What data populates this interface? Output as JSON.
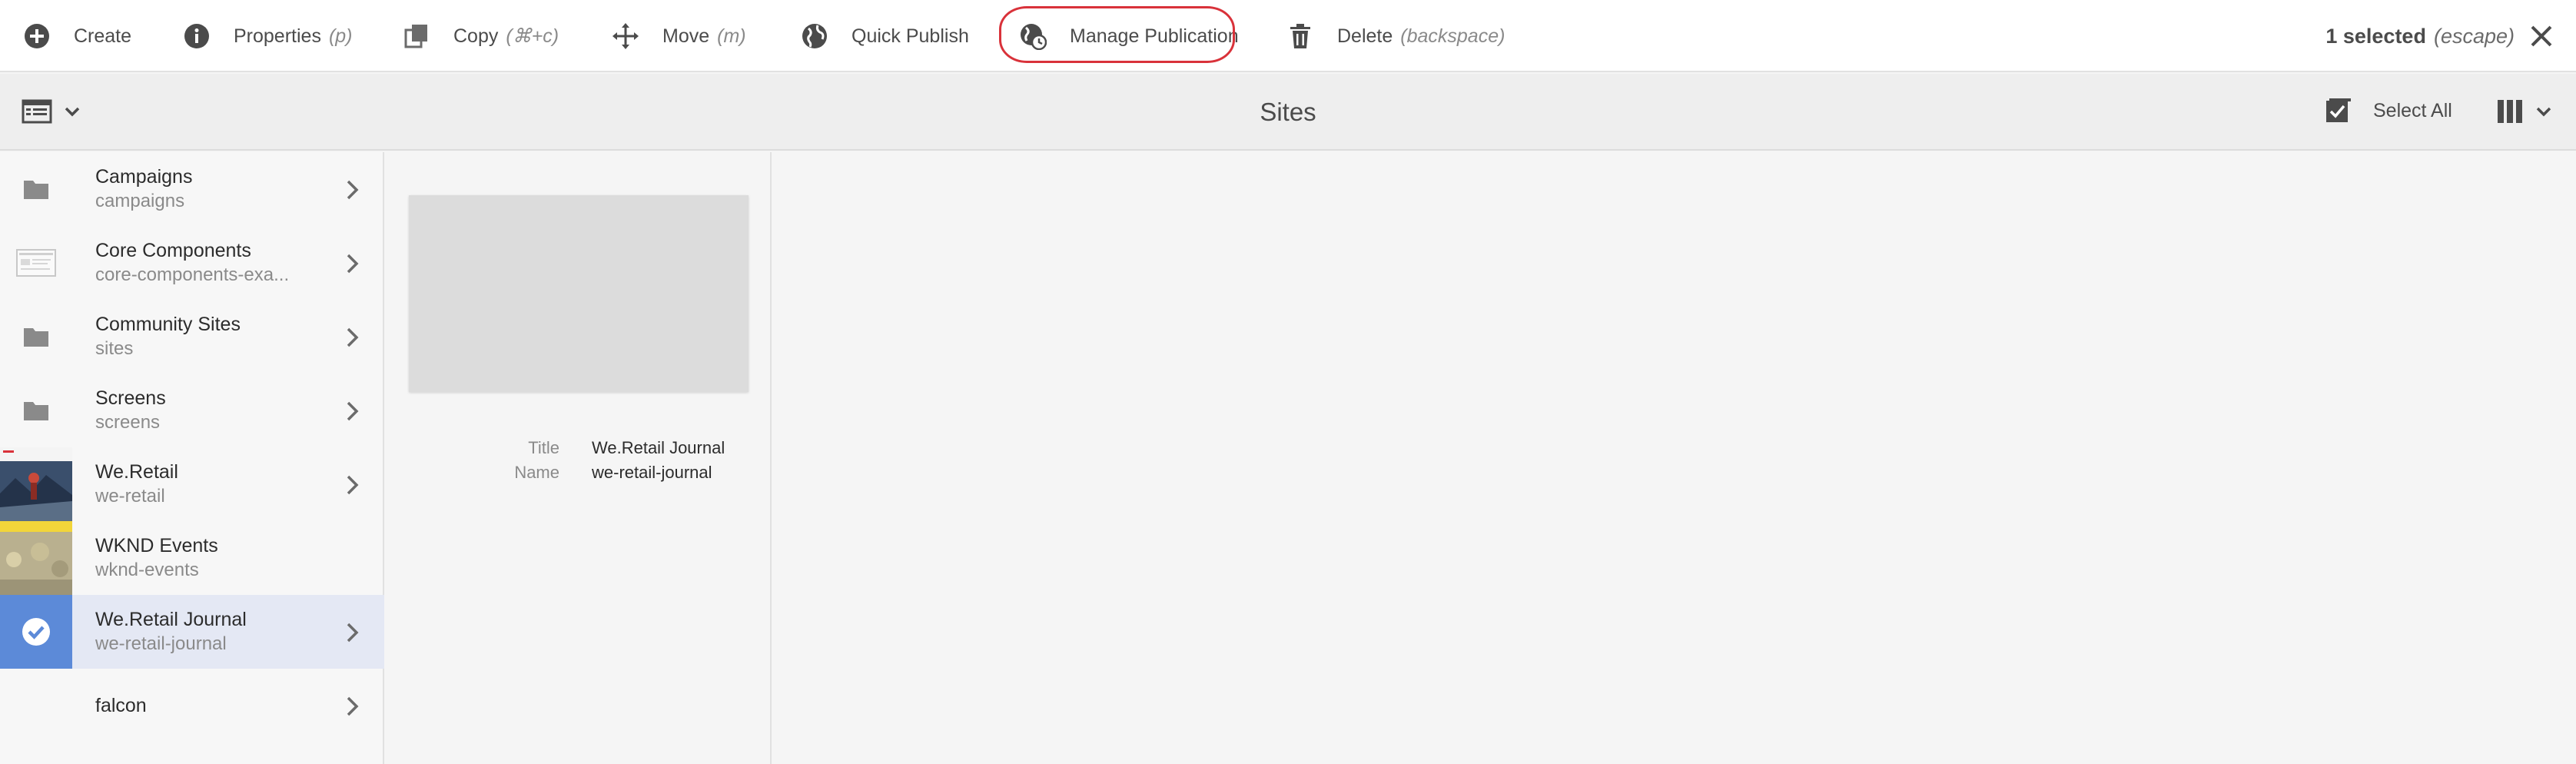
{
  "actionbar": {
    "actions": [
      {
        "label": "Create",
        "shortcut": "",
        "icon": "add-circle-icon"
      },
      {
        "label": "Properties",
        "shortcut": "(p)",
        "icon": "info-icon"
      },
      {
        "label": "Copy",
        "shortcut": "(⌘+c)",
        "icon": "copy-icon"
      },
      {
        "label": "Move",
        "shortcut": "(m)",
        "icon": "move-icon"
      },
      {
        "label": "Quick Publish",
        "shortcut": "",
        "icon": "globe-icon"
      },
      {
        "label": "Manage Publication",
        "shortcut": "",
        "icon": "globe-clock-icon"
      },
      {
        "label": "Delete",
        "shortcut": "(backspace)",
        "icon": "trash-icon"
      }
    ],
    "selection_count": "1 selected",
    "selection_hint": "(escape)",
    "highlight_color": "#d9323a"
  },
  "subheader": {
    "title": "Sites",
    "select_all": "Select All"
  },
  "column1": {
    "items": [
      {
        "title": "Campaigns",
        "name": "campaigns",
        "thumb": "folder-icon",
        "chevron": true
      },
      {
        "title": "Core Components",
        "name": "core-components-exa...",
        "thumb": "page-thumbnail-icon",
        "chevron": true
      },
      {
        "title": "Community Sites",
        "name": "sites",
        "thumb": "folder-icon",
        "chevron": true
      },
      {
        "title": "Screens",
        "name": "screens",
        "thumb": "folder-icon",
        "chevron": true
      },
      {
        "title": "We.Retail",
        "name": "we-retail",
        "thumb": "we-retail-thumbnail",
        "chevron": true
      },
      {
        "title": "WKND Events",
        "name": "wknd-events",
        "thumb": "wknd-thumbnail",
        "chevron": false
      },
      {
        "title": "We.Retail Journal",
        "name": "we-retail-journal",
        "thumb": "checkmark-icon",
        "chevron": true,
        "selected": true
      },
      {
        "title": "falcon",
        "name": "",
        "thumb": "none",
        "chevron": true
      }
    ]
  },
  "column2": {
    "meta": [
      {
        "key": "Title",
        "value": "We.Retail Journal"
      },
      {
        "key": "Name",
        "value": "we-retail-journal"
      }
    ]
  },
  "colors": {
    "selected_row_bg": "#e4e8f4",
    "selected_thumb_bg": "#5c8ad8"
  }
}
